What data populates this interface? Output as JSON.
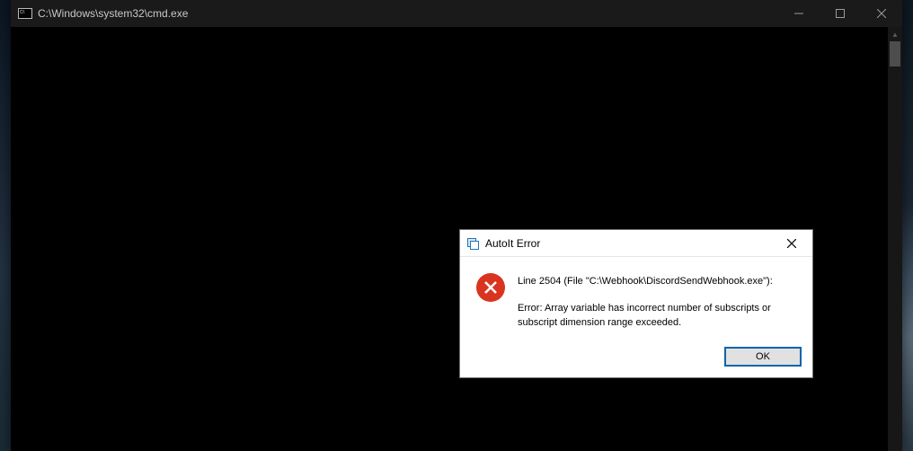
{
  "cmd": {
    "title": "C:\\Windows\\system32\\cmd.exe"
  },
  "dialog": {
    "title": "AutoIt Error",
    "line1": "Line 2504  (File \"C:\\Webhook\\DiscordSendWebhook.exe\"):",
    "line2": "Error: Array variable has incorrect number of subscripts or subscript dimension range exceeded.",
    "ok_label": "OK"
  }
}
